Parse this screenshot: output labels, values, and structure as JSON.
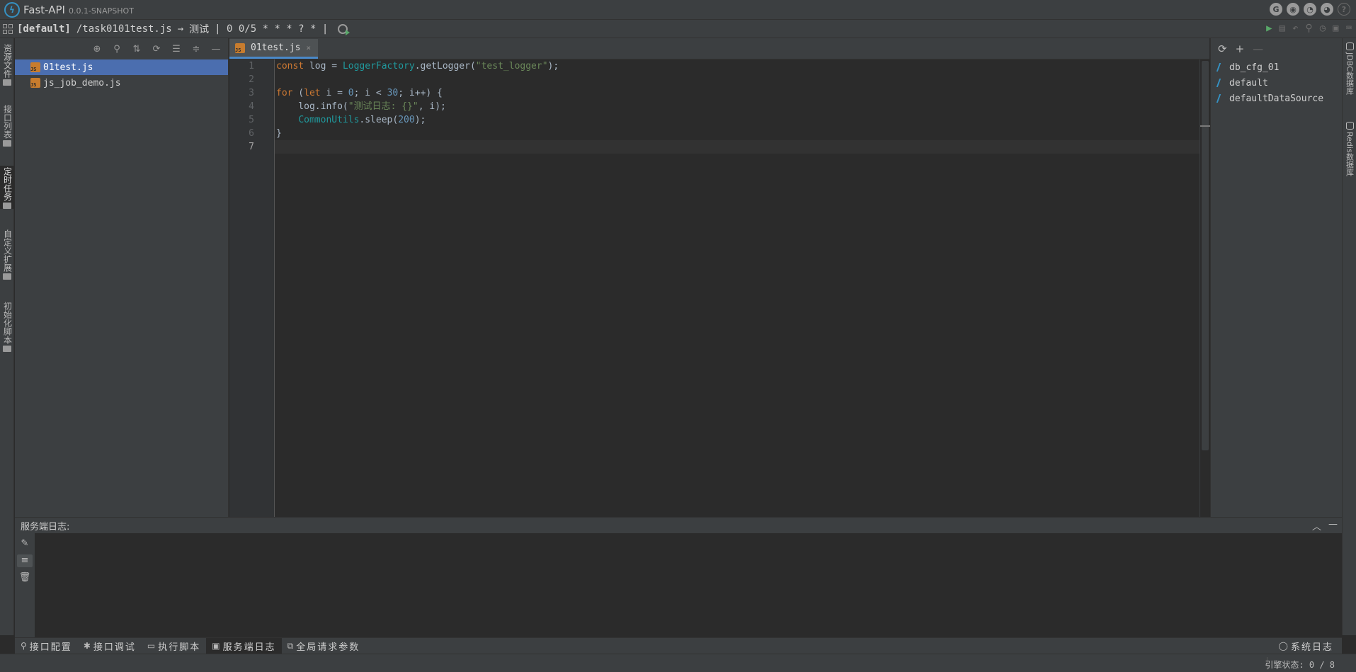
{
  "app": {
    "name": "Fast-API",
    "version": "0.0.1-SNAPSHOT"
  },
  "title_icons": [
    "google-icon",
    "github-icon",
    "qq-icon",
    "wechat-icon",
    "help-icon"
  ],
  "breadcrumb": {
    "project": "[default]",
    "path": "/task0101test.js",
    "arrow": "→",
    "task_name": "测试",
    "cron": "| 0 0/5 * * * ? * |"
  },
  "left_tabs": [
    "资源文件",
    "接口列表",
    "定时任务",
    "自定义扩展",
    "初始化脚本"
  ],
  "file_panel": {
    "files": [
      {
        "name": "01test.js",
        "selected": true
      },
      {
        "name": "js_job_demo.js",
        "selected": false
      }
    ]
  },
  "editor": {
    "tab_label": "01test.js",
    "tab_close": "×",
    "line_numbers": [
      "1",
      "2",
      "3",
      "4",
      "5",
      "6",
      "7"
    ],
    "current_line": 7
  },
  "db_panel": {
    "sources": [
      "db_cfg_01",
      "default",
      "defaultDataSource"
    ]
  },
  "right_tabs": [
    "JDBC数据库",
    "Redis数据库"
  ],
  "log_panel": {
    "title": "服务端日志:"
  },
  "bottom_tabs": [
    {
      "label": "接口配置",
      "icon": "⚲"
    },
    {
      "label": "接口调试",
      "icon": "✱"
    },
    {
      "label": "执行脚本",
      "icon": "▭"
    },
    {
      "label": "服务端日志",
      "icon": "▣"
    },
    {
      "label": "全局请求参数",
      "icon": "⧉"
    }
  ],
  "system_log_tab": "系统日志",
  "status": {
    "engine": "引擎状态: 0 / 8"
  },
  "colors": {
    "background": "#2b2b2b",
    "panel": "#3c3f41",
    "selection": "#4b6eaf",
    "accent": "#3592c4",
    "keyword": "#cc7832",
    "string": "#6a8759",
    "number": "#6897bb",
    "class": "#20999d"
  }
}
